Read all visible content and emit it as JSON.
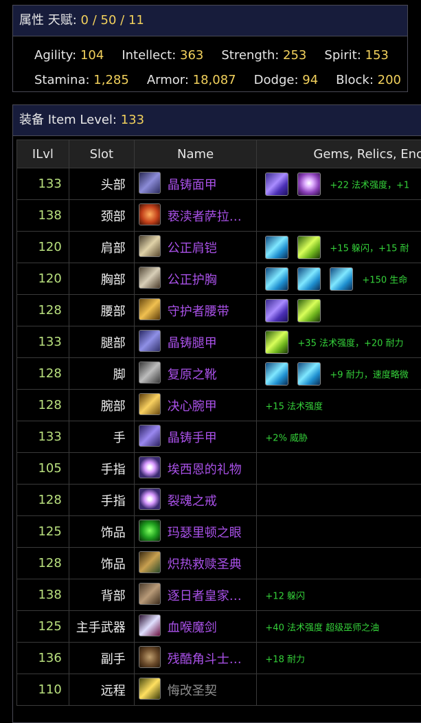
{
  "stats_panel": {
    "title": "属性 天赋:",
    "talents": "0 / 50 / 11",
    "row1": [
      {
        "label": "Agility:",
        "value": "104"
      },
      {
        "label": "Intellect:",
        "value": "363"
      },
      {
        "label": "Strength:",
        "value": "253"
      },
      {
        "label": "Spirit:",
        "value": "153"
      }
    ],
    "row2": [
      {
        "label": "Stamina:",
        "value": "1,285"
      },
      {
        "label": "Armor:",
        "value": "18,087"
      },
      {
        "label": "Dodge:",
        "value": "94"
      },
      {
        "label": "Block:",
        "value": "200"
      }
    ]
  },
  "gear_panel": {
    "title": "装备 Item Level:",
    "item_level": "133",
    "columns": [
      "ILvl",
      "Slot",
      "Name",
      "Gems, Relics, Enc"
    ],
    "rows": [
      {
        "ilvl": "133",
        "slot": "头部",
        "name": "晶铸面甲",
        "icon": "plate-helm-icon",
        "gems": [
          "purple",
          "pink"
        ],
        "bonus": "+22 法术强度，+1"
      },
      {
        "ilvl": "138",
        "slot": "颈部",
        "name": "亵渎者萨拉…",
        "icon": "necklace-icon",
        "gems": [],
        "bonus": ""
      },
      {
        "ilvl": "120",
        "slot": "肩部",
        "name": "公正肩铠",
        "icon": "shoulder-icon",
        "gems": [
          "blue",
          "green"
        ],
        "bonus": "+15 躲闪，+15 耐"
      },
      {
        "ilvl": "120",
        "slot": "胸部",
        "name": "公正护胸",
        "icon": "chest-icon",
        "gems": [
          "blue",
          "blue",
          "blue"
        ],
        "bonus": "+150 生命"
      },
      {
        "ilvl": "128",
        "slot": "腰部",
        "name": "守护者腰带",
        "icon": "belt-icon",
        "gems": [
          "purple",
          "green"
        ],
        "bonus": ""
      },
      {
        "ilvl": "133",
        "slot": "腿部",
        "name": "晶铸腿甲",
        "icon": "legs-icon",
        "gems": [
          "green"
        ],
        "bonus": "+35 法术强度，+20 耐力"
      },
      {
        "ilvl": "128",
        "slot": "脚",
        "name": "复原之靴",
        "icon": "boots-icon",
        "gems": [
          "blue",
          "blue"
        ],
        "bonus": "+9 耐力，速度略微"
      },
      {
        "ilvl": "128",
        "slot": "腕部",
        "name": "决心腕甲",
        "icon": "bracer-icon",
        "gems": [],
        "bonus": "+15 法术强度"
      },
      {
        "ilvl": "133",
        "slot": "手",
        "name": "晶铸手甲",
        "icon": "gauntlet-icon",
        "gems": [],
        "bonus": "+2% 威胁"
      },
      {
        "ilvl": "105",
        "slot": "手指",
        "name": "埃西恩的礼物",
        "icon": "ring-icon",
        "gems": [],
        "bonus": ""
      },
      {
        "ilvl": "128",
        "slot": "手指",
        "name": "裂魂之戒",
        "icon": "ring-icon",
        "gems": [],
        "bonus": ""
      },
      {
        "ilvl": "125",
        "slot": "饰品",
        "name": "玛瑟里顿之眼",
        "icon": "eye-trinket-icon",
        "gems": [],
        "bonus": ""
      },
      {
        "ilvl": "128",
        "slot": "饰品",
        "name": "炽热救赎圣典",
        "icon": "libram-icon",
        "gems": [],
        "bonus": ""
      },
      {
        "ilvl": "138",
        "slot": "背部",
        "name": "逐日者皇家…",
        "icon": "cloak-icon",
        "gems": [],
        "bonus": "+12 躲闪"
      },
      {
        "ilvl": "125",
        "slot": "主手武器",
        "name": "血喉魔剑",
        "icon": "sword-icon",
        "gems": [],
        "bonus": "+40 法术强度 超级巫师之油"
      },
      {
        "ilvl": "136",
        "slot": "副手",
        "name": "残酷角斗士…",
        "icon": "shield-icon",
        "gems": [],
        "bonus": "+18 耐力"
      },
      {
        "ilvl": "110",
        "slot": "远程",
        "name": "悔改圣契",
        "icon": "relic-icon",
        "gems": [],
        "bonus": "",
        "grey": true
      }
    ]
  },
  "colors": {
    "header_bg": "#171c3b",
    "value_yellow": "#f2d15c",
    "ilvl_green": "#b9e07e",
    "epic_purple": "#a951e8",
    "bonus_green": "#35d23a"
  }
}
